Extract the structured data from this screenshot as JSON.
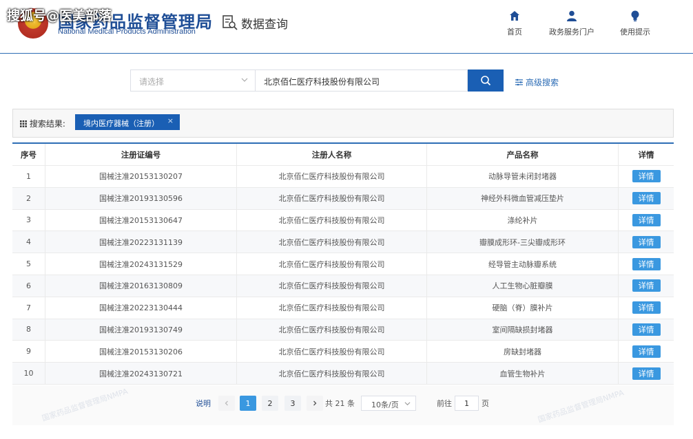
{
  "watermark": "搜狐号@医美部落",
  "agency": {
    "name_cn": "国家药品监督管理局",
    "name_en": "National Medical Products Administration"
  },
  "page_title": "数据查询",
  "nav": [
    {
      "label": "首页",
      "icon": "home-icon"
    },
    {
      "label": "政务服务门户",
      "icon": "user-icon"
    },
    {
      "label": "使用提示",
      "icon": "lightbulb-icon"
    }
  ],
  "search": {
    "select_placeholder": "请选择",
    "query_value": "北京佰仁医疗科技股份有限公司",
    "advanced_label": "高级搜索"
  },
  "results": {
    "label": "搜索结果:",
    "tag": "境内医疗器械（注册）",
    "tag_close": "×"
  },
  "table": {
    "headers": [
      "序号",
      "注册证编号",
      "注册人名称",
      "产品名称",
      "详情"
    ],
    "detail_label": "详情",
    "rows": [
      {
        "no": "1",
        "cert": "国械注准20153130207",
        "registrant": "北京佰仁医疗科技股份有限公司",
        "product": "动脉导管未闭封堵器"
      },
      {
        "no": "2",
        "cert": "国械注准20193130596",
        "registrant": "北京佰仁医疗科技股份有限公司",
        "product": "神经外科微血管减压垫片"
      },
      {
        "no": "3",
        "cert": "国械注准20153130647",
        "registrant": "北京佰仁医疗科技股份有限公司",
        "product": "涤纶补片"
      },
      {
        "no": "4",
        "cert": "国械注准20223131139",
        "registrant": "北京佰仁医疗科技股份有限公司",
        "product": "瓣膜成形环-三尖瓣成形环"
      },
      {
        "no": "5",
        "cert": "国械注准20243131529",
        "registrant": "北京佰仁医疗科技股份有限公司",
        "product": "经导管主动脉瓣系统"
      },
      {
        "no": "6",
        "cert": "国械注准20163130809",
        "registrant": "北京佰仁医疗科技股份有限公司",
        "product": "人工生物心脏瓣膜"
      },
      {
        "no": "7",
        "cert": "国械注准20223130444",
        "registrant": "北京佰仁医疗科技股份有限公司",
        "product": "硬脑（脊）膜补片"
      },
      {
        "no": "8",
        "cert": "国械注准20193130749",
        "registrant": "北京佰仁医疗科技股份有限公司",
        "product": "室间隔缺损封堵器"
      },
      {
        "no": "9",
        "cert": "国械注准20153130206",
        "registrant": "北京佰仁医疗科技股份有限公司",
        "product": "房缺封堵器"
      },
      {
        "no": "10",
        "cert": "国械注准20243130721",
        "registrant": "北京佰仁医疗科技股份有限公司",
        "product": "血管生物补片"
      }
    ]
  },
  "pagination": {
    "explain_label": "说明",
    "pages": [
      "1",
      "2",
      "3"
    ],
    "current_page": 1,
    "total_label": "共 21 条",
    "page_size": "10条/页",
    "goto_label": "前往",
    "goto_value": "1",
    "page_unit": "页"
  },
  "background_watermark": "国家药品监督管理局NMPA",
  "colors": {
    "primary": "#1a5fb4",
    "button": "#3a98e0"
  }
}
